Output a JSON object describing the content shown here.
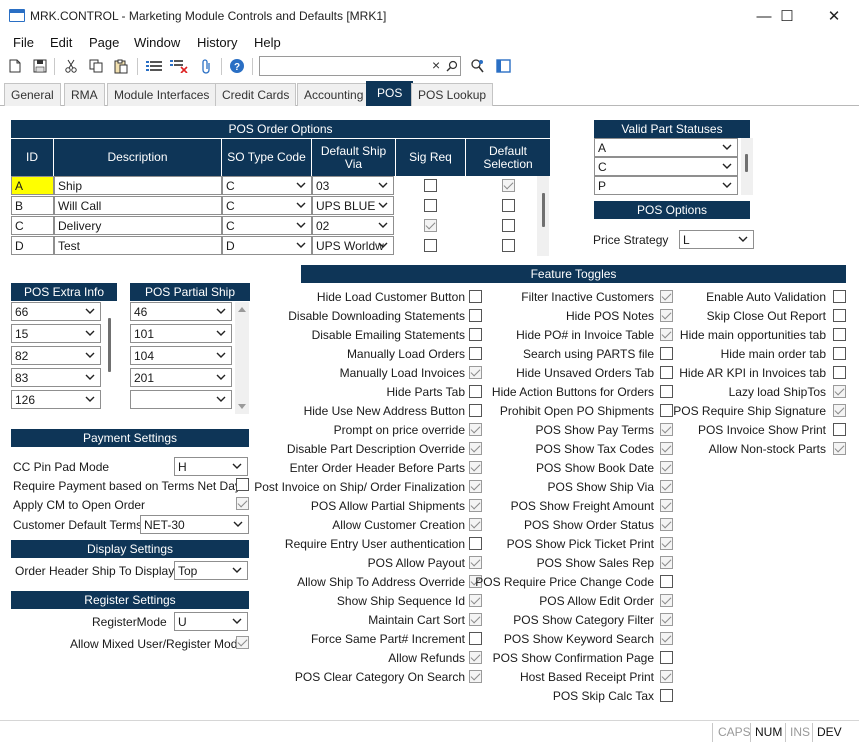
{
  "window": {
    "title": "MRK.CONTROL - Marketing Module Controls and Defaults [MRK1]",
    "minimize": "—",
    "maximize": "☐",
    "close": "✕"
  },
  "menu": [
    "File",
    "Edit",
    "Page",
    "Window",
    "History",
    "Help"
  ],
  "toolbar": {
    "icons": [
      "new-icon",
      "save-icon",
      "cut-icon",
      "copy-icon",
      "paste-icon",
      "list-icon",
      "delete-list-icon",
      "attach-icon",
      "help-icon",
      "search-icon",
      "binoculars-icon",
      "panel-icon"
    ],
    "search_value": "",
    "clear": "×"
  },
  "tabs": [
    "General",
    "RMA",
    "Module Interfaces",
    "Credit Cards",
    "Accounting",
    "POS",
    "POS Lookup"
  ],
  "active_tab": "POS",
  "pos_order_options": {
    "title": "POS Order Options",
    "headers": [
      "ID",
      "Description",
      "SO Type Code",
      "Default Ship Via",
      "Sig Req",
      "Default Selection"
    ],
    "rows": [
      {
        "id": "A",
        "description": "Ship",
        "so_type": "C",
        "ship_via": "03",
        "sig_req": false,
        "default_selection": true
      },
      {
        "id": "B",
        "description": "Will Call",
        "so_type": "C",
        "ship_via": "UPS BLUE",
        "sig_req": false,
        "default_selection": false
      },
      {
        "id": "C",
        "description": "Delivery",
        "so_type": "C",
        "ship_via": "02",
        "sig_req": true,
        "default_selection": false
      },
      {
        "id": "D",
        "description": "Test",
        "so_type": "D",
        "ship_via": "UPS Worldw",
        "sig_req": false,
        "default_selection": false
      }
    ]
  },
  "valid_part_statuses": {
    "title": "Valid Part Statuses",
    "values": [
      "A",
      "C",
      "P"
    ]
  },
  "pos_options": {
    "title": "POS Options",
    "price_strategy_label": "Price Strategy",
    "price_strategy": "L"
  },
  "pos_extra_info": {
    "title": "POS Extra Info",
    "values": [
      "66",
      "15",
      "82",
      "83",
      "126"
    ]
  },
  "pos_partial_ship": {
    "title": "POS Partial Ship",
    "values": [
      "46",
      "101",
      "104",
      "201",
      ""
    ]
  },
  "payment_settings": {
    "title": "Payment Settings",
    "cc_pin_pad_label": "CC Pin Pad Mode",
    "cc_pin_pad": "H",
    "require_payment_label": "Require Payment based on Terms Net Days",
    "require_payment": false,
    "apply_cm_label": "Apply CM to Open Order",
    "apply_cm": true,
    "customer_terms_label": "Customer Default Terms",
    "customer_terms": "NET-30"
  },
  "display_settings": {
    "title": "Display Settings",
    "order_header_label": "Order Header Ship To Display",
    "order_header": "Top"
  },
  "register_settings": {
    "title": "Register Settings",
    "register_mode_label": "RegisterMode",
    "register_mode": "U",
    "allow_mixed_label": "Allow Mixed User/Register Mode",
    "allow_mixed": true
  },
  "feature_toggles": {
    "title": "Feature Toggles",
    "col1": [
      {
        "label": "Hide Load Customer Button",
        "checked": false
      },
      {
        "label": "Disable Downloading Statements",
        "checked": false
      },
      {
        "label": "Disable Emailing Statements",
        "checked": false
      },
      {
        "label": "Manually Load Orders",
        "checked": false
      },
      {
        "label": "Manually Load Invoices",
        "checked": true
      },
      {
        "label": "Hide Parts Tab",
        "checked": false
      },
      {
        "label": "Hide Use New Address Button",
        "checked": false
      },
      {
        "label": "Prompt on price override",
        "checked": true
      },
      {
        "label": "Disable Part Description Override",
        "checked": true
      },
      {
        "label": "Enter Order Header Before Parts",
        "checked": true
      },
      {
        "label": "Post Invoice on Ship/ Order Finalization",
        "checked": true
      },
      {
        "label": "POS Allow Partial Shipments",
        "checked": true
      },
      {
        "label": "Allow Customer Creation",
        "checked": true
      },
      {
        "label": "Require Entry User authentication",
        "checked": false
      },
      {
        "label": "POS Allow Payout",
        "checked": true
      },
      {
        "label": "Allow Ship To Address Override",
        "checked": true
      },
      {
        "label": "Show Ship Sequence Id",
        "checked": true
      },
      {
        "label": "Maintain Cart Sort",
        "checked": true
      },
      {
        "label": "Force Same Part# Increment",
        "checked": false
      },
      {
        "label": "Allow Refunds",
        "checked": true
      },
      {
        "label": "POS Clear Category On Search",
        "checked": true
      }
    ],
    "col2": [
      {
        "label": "Filter Inactive Customers",
        "checked": true
      },
      {
        "label": "Hide POS Notes",
        "checked": true
      },
      {
        "label": "Hide PO# in Invoice Table",
        "checked": true
      },
      {
        "label": "Search using PARTS file",
        "checked": false
      },
      {
        "label": "Hide Unsaved Orders Tab",
        "checked": false
      },
      {
        "label": "Hide Action Buttons for Orders",
        "checked": false
      },
      {
        "label": "Prohibit Open PO Shipments",
        "checked": false
      },
      {
        "label": "POS Show Pay Terms",
        "checked": true
      },
      {
        "label": "POS Show Tax Codes",
        "checked": true
      },
      {
        "label": "POS Show Book Date",
        "checked": true
      },
      {
        "label": "POS Show Ship Via",
        "checked": true
      },
      {
        "label": "POS Show Freight Amount",
        "checked": true
      },
      {
        "label": "POS Show Order Status",
        "checked": true
      },
      {
        "label": "POS Show Pick Ticket Print",
        "checked": true
      },
      {
        "label": "POS Show Sales Rep",
        "checked": true
      },
      {
        "label": "POS Require Price Change Code",
        "checked": false
      },
      {
        "label": "POS Allow Edit Order",
        "checked": true
      },
      {
        "label": "POS Show Category Filter",
        "checked": true
      },
      {
        "label": "POS Show Keyword Search",
        "checked": true
      },
      {
        "label": "POS Show Confirmation Page",
        "checked": false
      },
      {
        "label": "Host Based Receipt Print",
        "checked": true
      },
      {
        "label": "POS Skip Calc Tax",
        "checked": false
      }
    ],
    "col3": [
      {
        "label": "Enable Auto Validation",
        "checked": false
      },
      {
        "label": "Skip Close Out Report",
        "checked": false
      },
      {
        "label": "Hide main opportunities tab",
        "checked": false
      },
      {
        "label": "Hide main order tab",
        "checked": false
      },
      {
        "label": "Hide AR KPI in Invoices tab",
        "checked": false
      },
      {
        "label": "Lazy load ShipTos",
        "checked": true
      },
      {
        "label": "POS Require Ship Signature",
        "checked": true
      },
      {
        "label": "POS Invoice Show Print",
        "checked": false
      },
      {
        "label": "Allow Non-stock Parts",
        "checked": true
      }
    ]
  },
  "statusbar": [
    "CAPS",
    "NUM",
    "INS",
    "DEV"
  ],
  "colors": {
    "header": "#0e3557",
    "highlight": "#ffff00"
  }
}
